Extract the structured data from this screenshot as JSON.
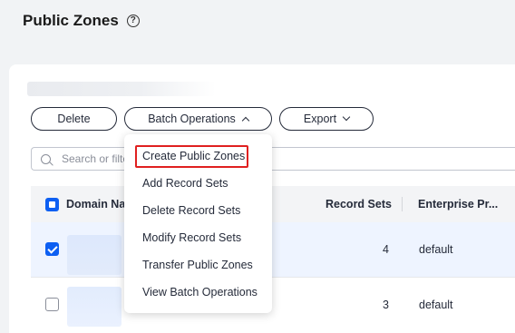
{
  "header": {
    "title": "Public Zones",
    "help_icon": "?"
  },
  "toolbar": {
    "delete_label": "Delete",
    "batch_label": "Batch Operations",
    "export_label": "Export"
  },
  "search": {
    "placeholder": "Search or filte"
  },
  "table": {
    "columns": [
      "Domain Na",
      "Record Sets",
      "Enterprise Pr..."
    ],
    "rows": [
      {
        "checked": true,
        "record_sets": "4",
        "enterprise_project": "default"
      },
      {
        "checked": false,
        "record_sets": "3",
        "enterprise_project": "default"
      }
    ]
  },
  "batch_menu": {
    "items": [
      "Create Public Zones",
      "Add Record Sets",
      "Delete Record Sets",
      "Modify Record Sets",
      "Transfer Public Zones",
      "View Batch Operations"
    ],
    "highlighted_index": 0
  },
  "colors": {
    "primary": "#0d5ff2",
    "highlight_border": "#e02020",
    "selected_row": "#eef4ff"
  }
}
